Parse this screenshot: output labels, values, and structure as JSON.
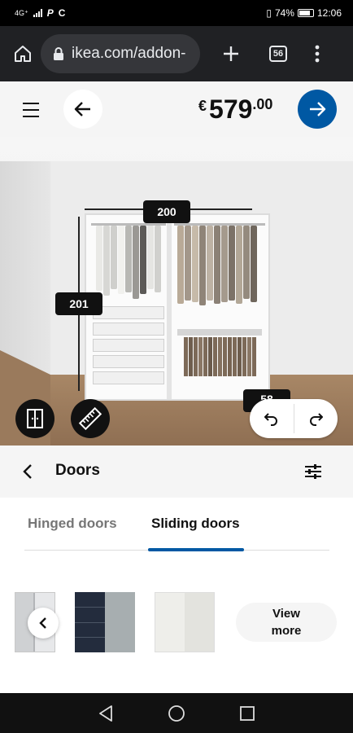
{
  "status_bar": {
    "network": "4G⁺",
    "battery": "74%",
    "time": "12:06"
  },
  "browser": {
    "url": "ikea.com/addon-",
    "tab_count": "56",
    "icons": [
      "home-icon",
      "lock-icon",
      "plus-icon",
      "tabs-icon",
      "more-vert-icon"
    ]
  },
  "header": {
    "currency": "€",
    "price_int": "579",
    "price_dec": ".00"
  },
  "viewer": {
    "dim_width": "200",
    "dim_height": "201",
    "dim_depth": "58"
  },
  "panel": {
    "title": "Doors"
  },
  "tabs": [
    {
      "label": "Hinged doors",
      "active": false
    },
    {
      "label": "Sliding doors",
      "active": true
    }
  ],
  "products": {
    "view_more_line1": "View",
    "view_more_line2": "more"
  },
  "colors": {
    "accent": "#0058a3",
    "dark": "#111111",
    "header_bg": "#f5f5f5"
  }
}
